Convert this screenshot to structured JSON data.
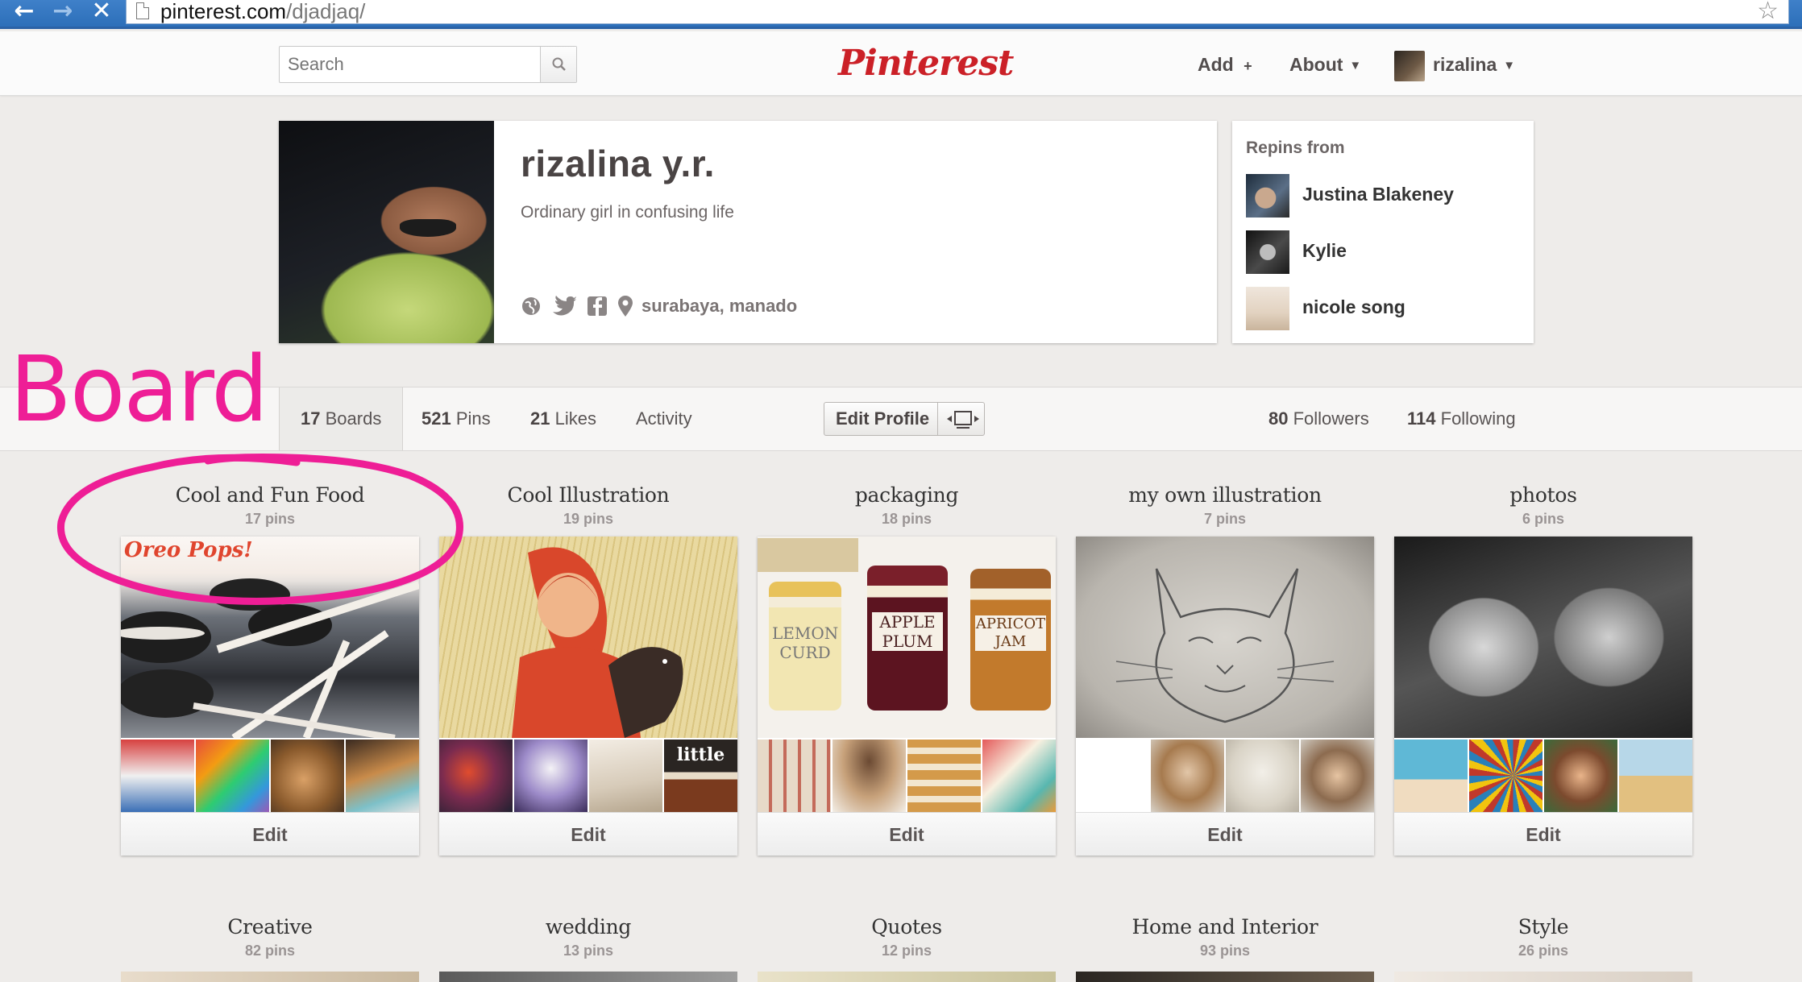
{
  "browser": {
    "url_host": "pinterest.com",
    "url_path": "/djadjaq/"
  },
  "header": {
    "search_placeholder": "Search",
    "logo": "Pinterest",
    "add_label": "Add",
    "add_suffix": "+",
    "about_label": "About",
    "username": "rizalina",
    "brand_color": "#cb2027"
  },
  "profile": {
    "name": "rizalina y.r.",
    "bio": "Ordinary girl in confusing life",
    "location": "surabaya, manado",
    "link_icons": [
      "globe-icon",
      "twitter-icon",
      "facebook-icon",
      "location-pin-icon"
    ]
  },
  "repins": {
    "title": "Repins from",
    "users": [
      {
        "name": "Justina Blakeney"
      },
      {
        "name": "Kylie"
      },
      {
        "name": "nicole song"
      }
    ]
  },
  "annotation": {
    "label": "Board",
    "color": "#ee1e96"
  },
  "profile_nav": {
    "boards_count": "17",
    "boards_label": "Boards",
    "pins_count": "521",
    "pins_label": "Pins",
    "likes_count": "21",
    "likes_label": "Likes",
    "activity_label": "Activity",
    "edit_profile_label": "Edit Profile",
    "followers_count": "80",
    "followers_label": "Followers",
    "following_count": "114",
    "following_label": "Following"
  },
  "boards": [
    {
      "title": "Cool and Fun Food",
      "pins": "17 pins",
      "edit": "Edit",
      "cover_text": "Oreo Pops!"
    },
    {
      "title": "Cool Illustration",
      "pins": "19 pins",
      "edit": "Edit",
      "thumb_text": "little"
    },
    {
      "title": "packaging",
      "pins": "18 pins",
      "edit": "Edit",
      "jar_labels": [
        "LEMON CURD",
        "APPLE PLUM",
        "APRICOT JAM"
      ]
    },
    {
      "title": "my own illustration",
      "pins": "7 pins",
      "edit": "Edit"
    },
    {
      "title": "photos",
      "pins": "6 pins",
      "edit": "Edit"
    },
    {
      "title": "Creative",
      "pins": "82 pins"
    },
    {
      "title": "wedding",
      "pins": "13 pins"
    },
    {
      "title": "Quotes",
      "pins": "12 pins"
    },
    {
      "title": "Home and Interior",
      "pins": "93 pins"
    },
    {
      "title": "Style",
      "pins": "26 pins"
    }
  ]
}
